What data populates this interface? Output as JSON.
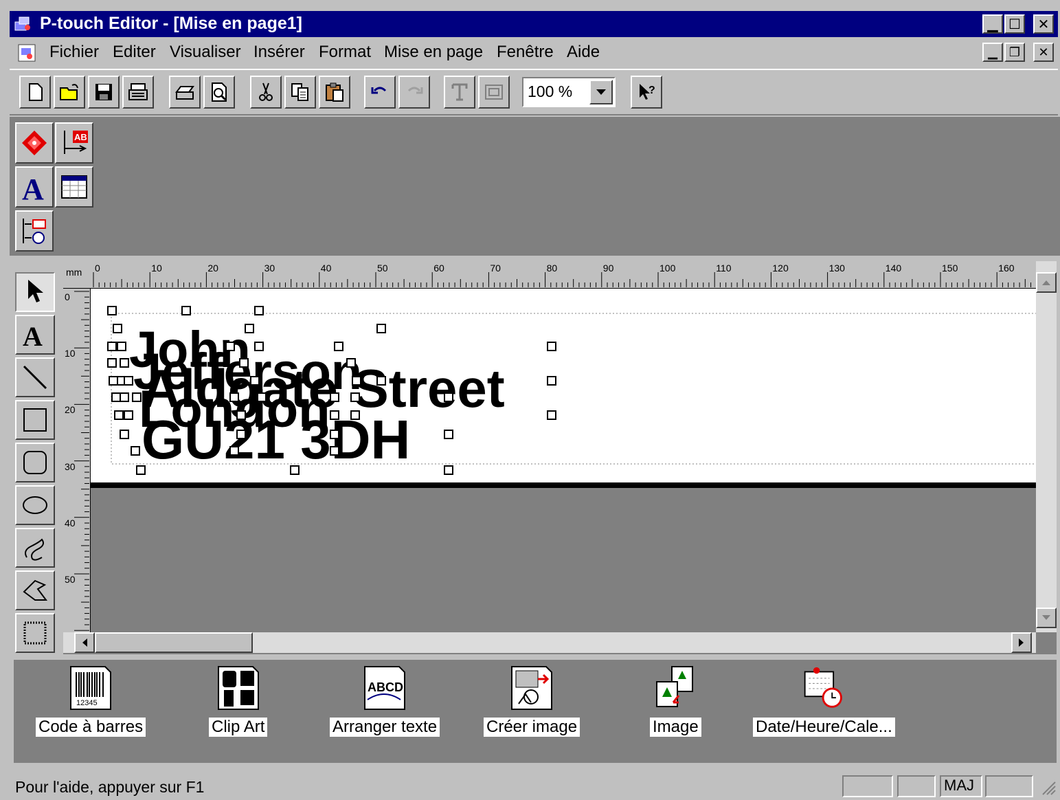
{
  "window": {
    "title": "P-touch Editor - [Mise en page1]",
    "controls": [
      "minimize",
      "maximize",
      "close"
    ]
  },
  "menu": {
    "items": [
      {
        "label": "Fichier"
      },
      {
        "label": "Editer"
      },
      {
        "label": "Visualiser"
      },
      {
        "label": "Insérer"
      },
      {
        "label": "Format"
      },
      {
        "label": "Mise en page"
      },
      {
        "label": "Fenêtre"
      },
      {
        "label": "Aide"
      }
    ]
  },
  "toolbar": {
    "buttons": [
      "new-icon",
      "open-icon",
      "save-icon",
      "print-setup-icon",
      "print-icon",
      "print-preview-icon",
      "cut-icon",
      "copy-icon",
      "paste-icon",
      "undo-icon",
      "redo-icon",
      "text-frame-icon",
      "frame-icon",
      "help-pointer-icon"
    ],
    "zoom": "100 %"
  },
  "ruler": {
    "unit": "mm",
    "h_marks": [
      "0",
      "10",
      "20",
      "30",
      "40",
      "50",
      "60",
      "70",
      "80",
      "90",
      "100",
      "110",
      "120",
      "130",
      "140",
      "150",
      "160"
    ],
    "v_marks": [
      "0",
      "10",
      "20",
      "30",
      "40",
      "50"
    ]
  },
  "label": {
    "lines": [
      "John",
      "Jefferson",
      "Aldgate Street",
      "London",
      "GU21 3DH"
    ]
  },
  "palette": {
    "items": [
      {
        "label": "Code à barres",
        "icon": "barcode-icon"
      },
      {
        "label": "Clip Art",
        "icon": "clipart-icon"
      },
      {
        "label": "Arranger texte",
        "icon": "arrange-text-icon"
      },
      {
        "label": "Créer image",
        "icon": "create-image-icon"
      },
      {
        "label": "Image",
        "icon": "image-icon"
      },
      {
        "label": "Date/Heure/Cale...",
        "icon": "date-time-icon"
      }
    ]
  },
  "status": {
    "text": "Pour l'aide, appuyer sur F1",
    "panels": [
      "",
      "",
      "MAJ",
      ""
    ]
  }
}
